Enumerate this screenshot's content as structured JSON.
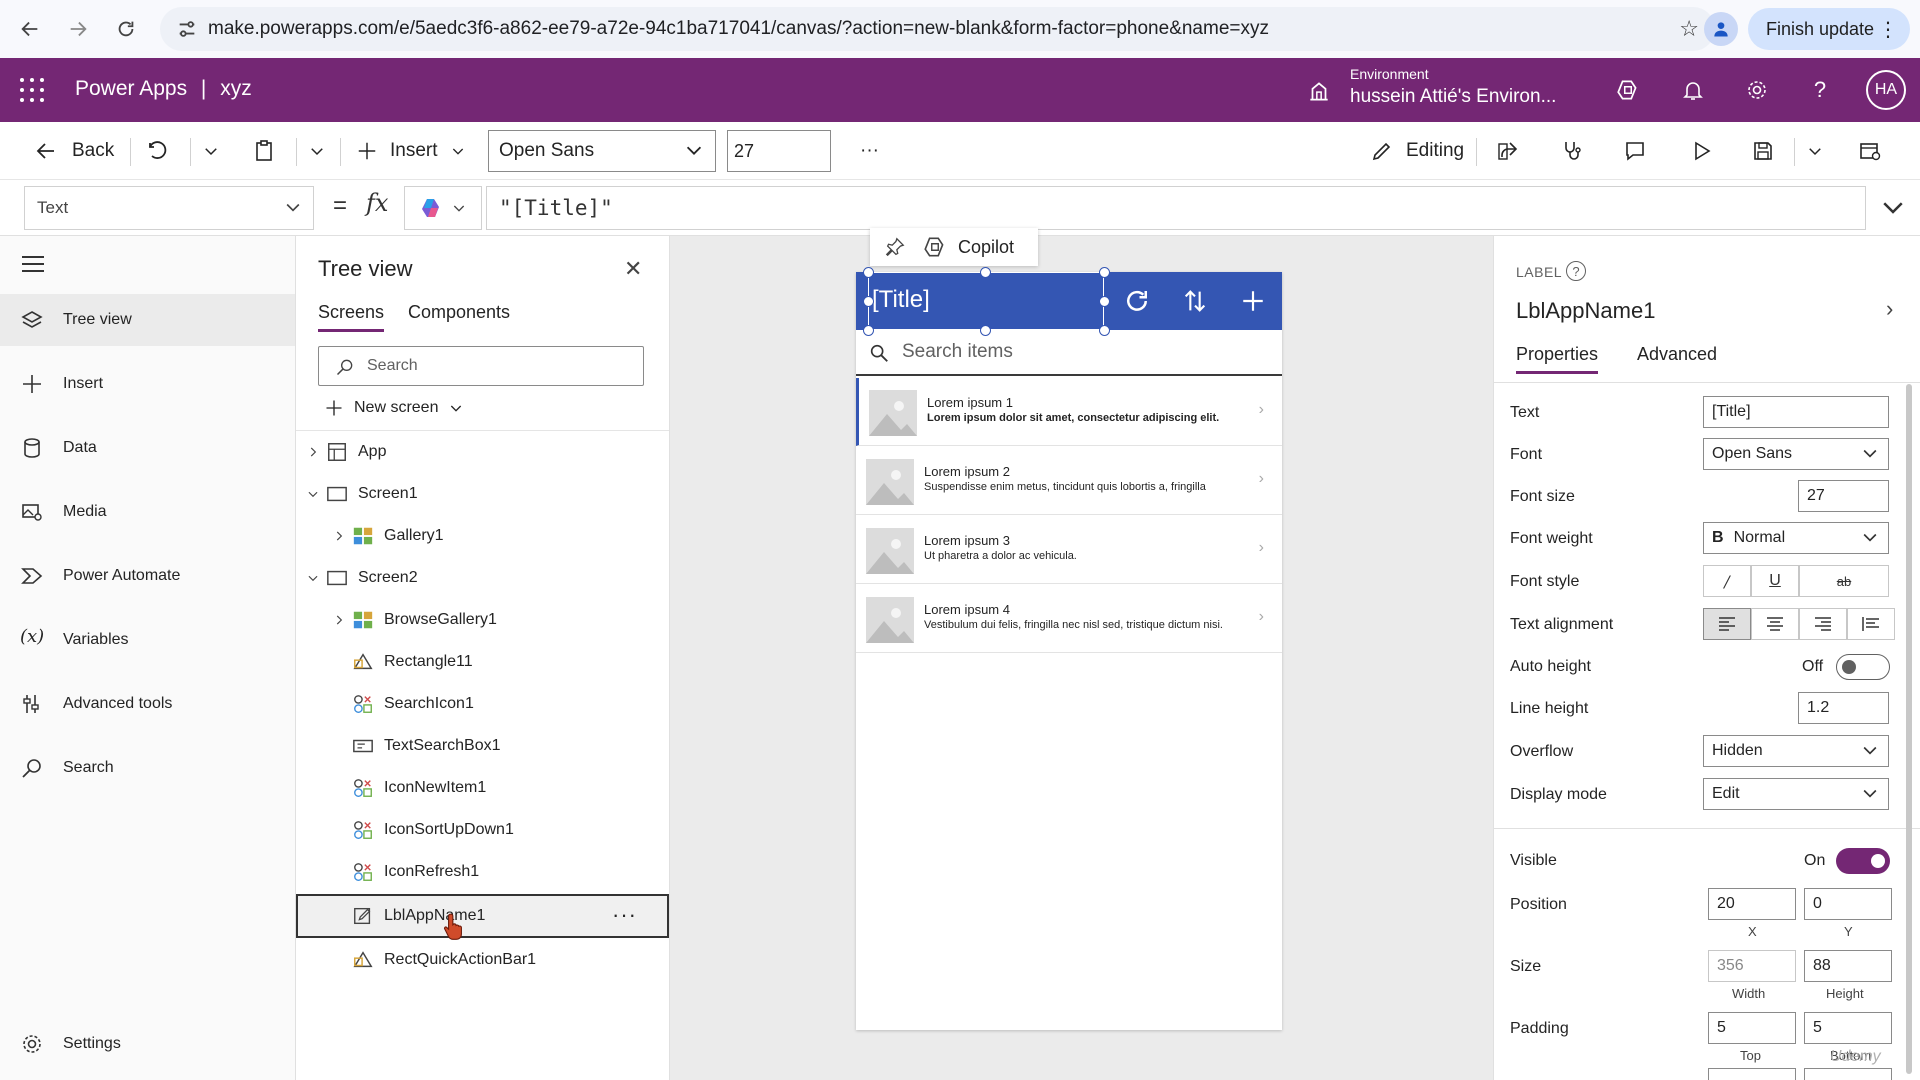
{
  "browser": {
    "url": "make.powerapps.com/e/5aedc3f6-a862-ee79-a72e-94c1ba717041/canvas/?action=new-blank&form-factor=phone&name=xyz",
    "finish_update": "Finish update"
  },
  "header": {
    "app_name": "Power Apps",
    "separator": "|",
    "file_name": "xyz",
    "env_label": "Environment",
    "env_name": "hussein Attié's Environ...",
    "avatar": "HA"
  },
  "command_bar": {
    "back": "Back",
    "insert": "Insert",
    "font": "Open Sans",
    "font_size": "27",
    "more": "···",
    "editing": "Editing"
  },
  "formula_bar": {
    "property": "Text",
    "equals": "=",
    "fx": "fx",
    "formula": "\"[Title]\""
  },
  "left_nav": {
    "items": [
      {
        "label": "Tree view",
        "icon": "layers-icon"
      },
      {
        "label": "Insert",
        "icon": "plus-icon"
      },
      {
        "label": "Data",
        "icon": "database-icon"
      },
      {
        "label": "Media",
        "icon": "media-icon"
      },
      {
        "label": "Power Automate",
        "icon": "power-automate-icon"
      },
      {
        "label": "Variables",
        "icon": "variables-icon"
      },
      {
        "label": "Advanced tools",
        "icon": "tools-icon"
      },
      {
        "label": "Search",
        "icon": "search-icon"
      }
    ],
    "settings": "Settings"
  },
  "tree_view": {
    "title": "Tree view",
    "tabs": [
      "Screens",
      "Components"
    ],
    "search_placeholder": "Search",
    "new_screen": "New screen",
    "rows": [
      {
        "label": "App",
        "level": 0
      },
      {
        "label": "Screen1",
        "level": 0
      },
      {
        "label": "Gallery1",
        "level": 1
      },
      {
        "label": "Screen2",
        "level": 0
      },
      {
        "label": "BrowseGallery1",
        "level": 1
      },
      {
        "label": "Rectangle11",
        "level": 1
      },
      {
        "label": "SearchIcon1",
        "level": 1
      },
      {
        "label": "TextSearchBox1",
        "level": 1
      },
      {
        "label": "IconNewItem1",
        "level": 1
      },
      {
        "label": "IconSortUpDown1",
        "level": 1
      },
      {
        "label": "IconRefresh1",
        "level": 1
      },
      {
        "label": "LblAppName1",
        "level": 1
      },
      {
        "label": "RectQuickActionBar1",
        "level": 1
      }
    ],
    "more": "···"
  },
  "canvas": {
    "copilot": "Copilot",
    "title": "[Title]",
    "search_placeholder": "Search items",
    "items": [
      {
        "title": "Lorem ipsum 1",
        "subtitle": "Lorem ipsum dolor sit amet, consectetur adipiscing elit."
      },
      {
        "title": "Lorem ipsum 2",
        "subtitle": "Suspendisse enim metus, tincidunt quis lobortis a, fringilla"
      },
      {
        "title": "Lorem ipsum 3",
        "subtitle": "Ut pharetra a dolor ac vehicula."
      },
      {
        "title": "Lorem ipsum 4",
        "subtitle": "Vestibulum dui felis, fringilla nec nisl sed, tristique dictum nisi."
      }
    ]
  },
  "properties": {
    "category": "LABEL",
    "control_name": "LblAppName1",
    "tabs": [
      "Properties",
      "Advanced"
    ],
    "text_label": "Text",
    "text_value": "[Title]",
    "font_label": "Font",
    "font_value": "Open Sans",
    "font_size_label": "Font size",
    "font_size_value": "27",
    "font_weight_label": "Font weight",
    "font_weight_value": "Normal",
    "font_style_label": "Font style",
    "text_alignment_label": "Text alignment",
    "auto_height_label": "Auto height",
    "auto_height_value": "Off",
    "line_height_label": "Line height",
    "line_height_value": "1.2",
    "overflow_label": "Overflow",
    "overflow_value": "Hidden",
    "display_mode_label": "Display mode",
    "display_mode_value": "Edit",
    "visible_label": "Visible",
    "visible_value": "On",
    "position_label": "Position",
    "position_x": "20",
    "position_y": "0",
    "x_caption": "X",
    "y_caption": "Y",
    "size_label": "Size",
    "size_width": "356",
    "size_height": "88",
    "width_caption": "Width",
    "height_caption": "Height",
    "padding_label": "Padding",
    "padding_top": "5",
    "padding_bottom": "5",
    "top_caption": "Top",
    "bottom_caption": "Bottom"
  },
  "watermark": "Udemy",
  "colors": {
    "header_bg": "#742774",
    "title_bar": "#3456b3",
    "toggle_on": "#742774"
  }
}
